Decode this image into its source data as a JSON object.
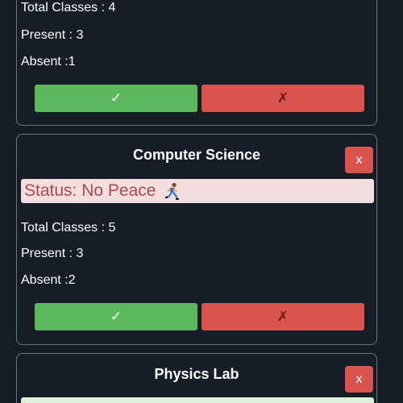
{
  "cards": [
    {
      "stats": {
        "total": "Total Classes : 4",
        "present": "Present : 3",
        "absent": "Absent :1"
      },
      "buttons": {
        "present_icon": "✓",
        "absent_icon": "✗"
      }
    },
    {
      "title": "Computer Science",
      "close_label": "x",
      "status": {
        "text": "Status: No Peace",
        "icon": "running-person-icon"
      },
      "stats": {
        "total": "Total Classes : 5",
        "present": "Present : 3",
        "absent": "Absent :2"
      },
      "buttons": {
        "present_icon": "✓",
        "absent_icon": "✗"
      }
    },
    {
      "title": "Physics Lab",
      "close_label": "x"
    }
  ],
  "colors": {
    "background": "#161d26",
    "card_border": "#6d737b",
    "success": "#5cb85c",
    "danger": "#d9534f",
    "status_bad_bg": "#f2dede",
    "status_bad_text": "#b04a47",
    "status_good_bg": "#dff0d8"
  }
}
